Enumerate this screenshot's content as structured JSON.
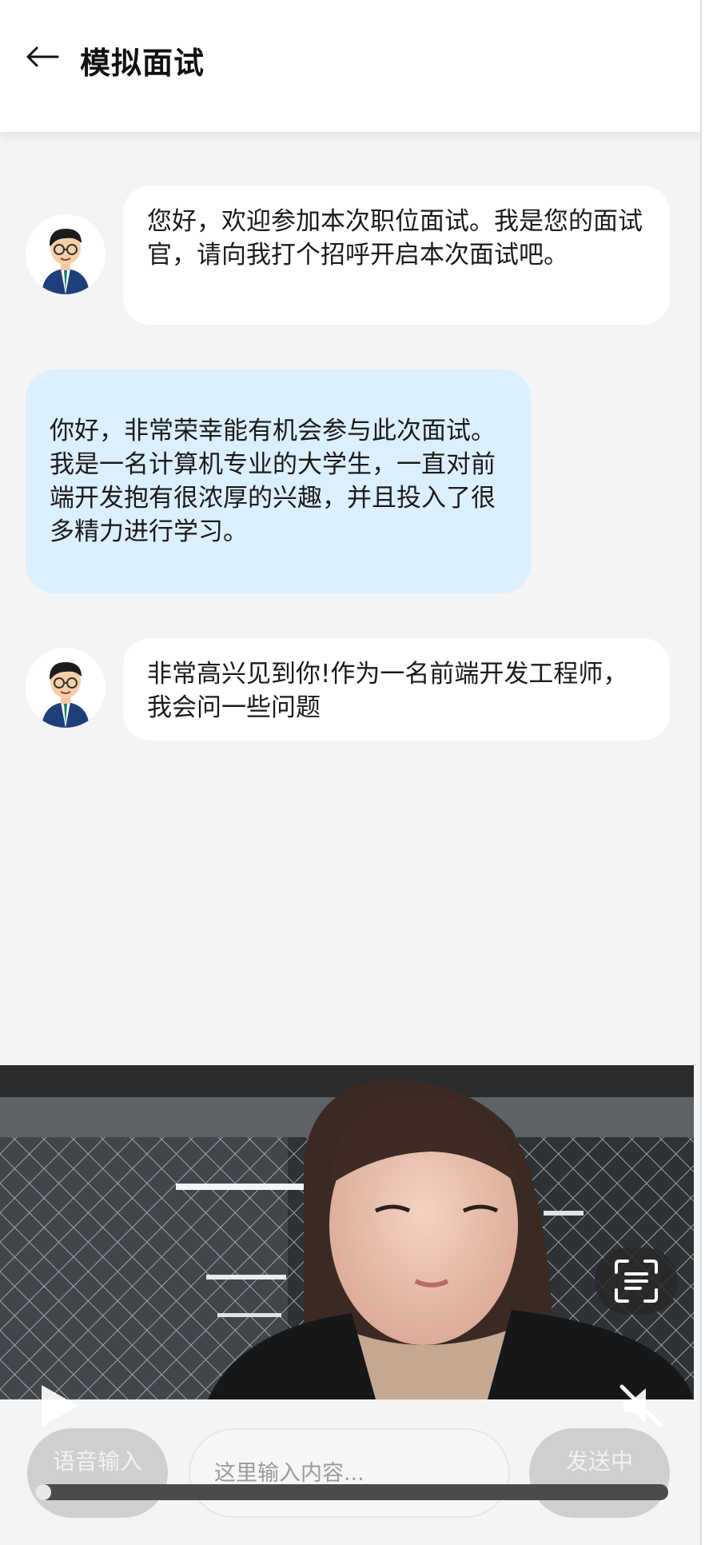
{
  "header": {
    "back_icon": "back-arrow-icon",
    "title": "模拟面试"
  },
  "chat": {
    "messages": [
      {
        "sender": "interviewer",
        "text": "您好，欢迎参加本次职位面试。我是您的面试官，请向我打个招呼开启本次面试吧。"
      },
      {
        "sender": "user",
        "text": "你好，非常荣幸能有机会参与此次面试。我是一名计算机专业的大学生，一直对前端开发抱有很浓厚的兴趣，并且投入了很多精力进行学习。"
      },
      {
        "sender": "interviewer",
        "text": "非常高兴见到你!作为一名前端开发工程师，我会问一些问题"
      }
    ]
  },
  "video": {
    "play_icon": "play-icon",
    "mute_icon": "volume-muted-icon",
    "scan_icon": "scan-text-icon",
    "progress": 0.01
  },
  "input_bar": {
    "voice_label": "语音输入",
    "placeholder": "这里输入内容...",
    "send_label": "发送中"
  },
  "colors": {
    "page_bg": "#f4f4f4",
    "user_bubble": "#dcefff",
    "ai_bubble": "#ffffff",
    "button_gray": "#cfcfcf"
  }
}
